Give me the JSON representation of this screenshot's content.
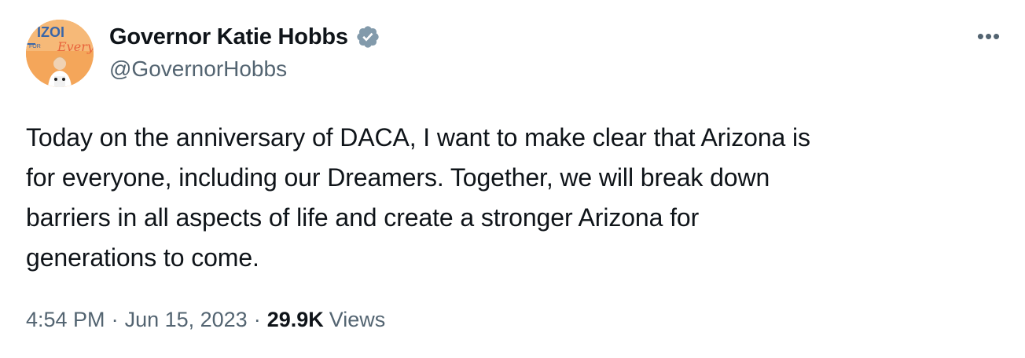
{
  "author": {
    "name": "Governor Katie Hobbs",
    "handle": "@GovernorHobbs",
    "avatar_banner_text": "IZOI FOR Every"
  },
  "tweet": {
    "lines": [
      "Today on the anniversary of DACA, I want to make clear that Arizona is",
      "for everyone, including our Dreamers. Together, we will break down",
      "barriers in all aspects of life and create a stronger Arizona for",
      "generations to come."
    ]
  },
  "meta": {
    "time": "4:54 PM",
    "separator": "·",
    "date": "Jun 15, 2023",
    "views_count": "29.9K",
    "views_label": "Views"
  },
  "icons": {
    "verified": "verified-badge-icon",
    "more": "more-options-icon"
  },
  "colors": {
    "text_primary": "#0f1419",
    "text_secondary": "#536471",
    "verified_badge": "#829aab",
    "avatar_bg": "#f2a14a"
  }
}
